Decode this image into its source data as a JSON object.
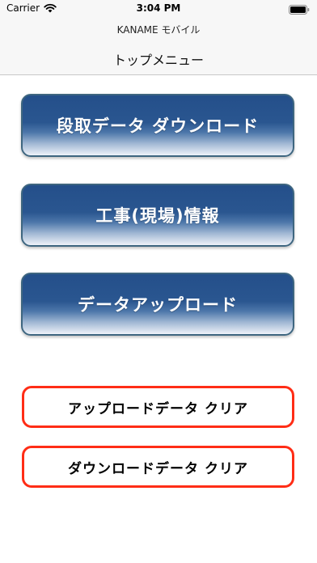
{
  "status_bar": {
    "carrier": "Carrier",
    "time": "3:04 PM"
  },
  "header": {
    "app_name": "KANAME モバイル",
    "title": "トップメニュー"
  },
  "menu": {
    "download_setup_label": "段取データ ダウンロード",
    "site_info_label": "工事(現場)情報",
    "data_upload_label": "データアップロード"
  },
  "clear_actions": {
    "upload_clear_label": "アップロードデータ クリア",
    "download_clear_label": "ダウンロードデータ クリア"
  },
  "colors": {
    "button_blue": "#2a5690",
    "clear_border_red": "#ff2d16"
  },
  "icons": [
    "wifi-icon",
    "battery-icon"
  ]
}
